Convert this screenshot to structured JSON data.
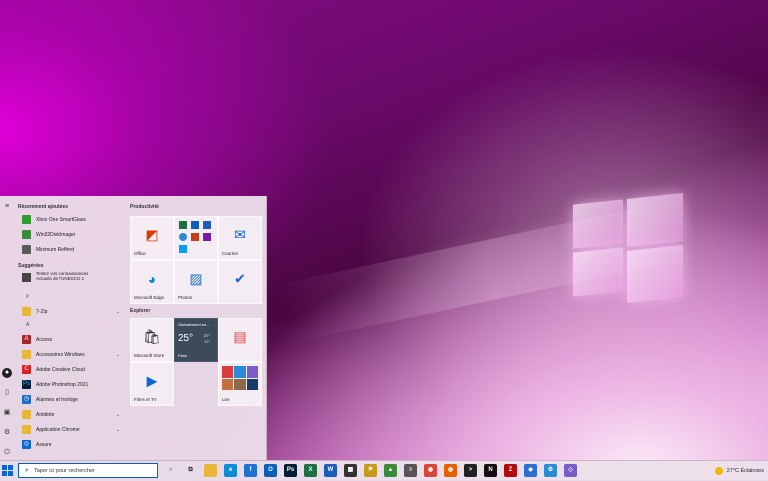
{
  "rail": {
    "icons": [
      "hamburger-icon",
      "user-icon",
      "document-icon",
      "pictures-icon",
      "settings-icon",
      "power-icon"
    ]
  },
  "apps": {
    "recent_heading": "Récemment ajoutées",
    "recent": [
      {
        "label": "Xbox One SmartGlass",
        "color": "#2d9b2d"
      },
      {
        "label": "Win32DiskImager",
        "color": "#3a8a3a"
      },
      {
        "label": "Minimum Refferd",
        "color": "#5a5a5a"
      }
    ],
    "suggestions_heading": "Suggérées",
    "suggestion": {
      "line1": "Testez vos connaissances",
      "line2": "Actualis de l'UNESCO 1",
      "color": "#444"
    },
    "letter_hash": "#",
    "folder_7zip": "7-Zip",
    "letter_a": "A",
    "list": [
      {
        "label": "Access",
        "color": "#a4262c",
        "glyph": "A"
      },
      {
        "label": "Accessoires Windows",
        "color": "#e8b73a",
        "glyph": "",
        "chevron": true
      },
      {
        "label": "Adobe Creative Cloud",
        "color": "#da1f26",
        "glyph": "C"
      },
      {
        "label": "Adobe Photoshop 2021",
        "color": "#001e36",
        "glyph": "Ps"
      },
      {
        "label": "Alarmes et horloge",
        "color": "#1a6fc4",
        "glyph": "◷"
      },
      {
        "label": "Antidote",
        "color": "#e8b73a",
        "glyph": "",
        "chevron": true
      },
      {
        "label": "Application Chrome",
        "color": "#e8b73a",
        "glyph": "",
        "chevron": true
      },
      {
        "label": "Assure",
        "color": "#0a66d0",
        "glyph": "◎"
      }
    ]
  },
  "tiles": {
    "productivity_heading": "Productivité",
    "explore_heading": "Explorer",
    "office": "Office",
    "mail": "Courrier",
    "edge": "Microsoft Edge",
    "photos": "Photos",
    "store": "Microsoft Store",
    "weather_top": "Globalement en...",
    "weather_temp": "25°",
    "weather_hi": "27°",
    "weather_lo": "15°",
    "weather_city": "Paris",
    "films": "Films et TV",
    "play": "Lire"
  },
  "taskbar": {
    "search_placeholder": "Taper ici pour rechercher",
    "apps": [
      {
        "name": "cortana-icon",
        "color": "#333",
        "glyph": "○"
      },
      {
        "name": "task-view-icon",
        "color": "#333",
        "glyph": "⧉"
      },
      {
        "name": "file-explorer-icon",
        "color": "#e8b73a",
        "glyph": ""
      },
      {
        "name": "edge-icon",
        "color": "#0c8bd6",
        "glyph": "e"
      },
      {
        "name": "firefox-icon",
        "color": "#1c73d4",
        "glyph": "f"
      },
      {
        "name": "outlook-icon",
        "color": "#0a5fb8",
        "glyph": "O"
      },
      {
        "name": "photoshop-icon",
        "color": "#001e36",
        "glyph": "Ps"
      },
      {
        "name": "excel-icon",
        "color": "#1d7044",
        "glyph": "X"
      },
      {
        "name": "word-icon",
        "color": "#1d5bbd",
        "glyph": "W"
      },
      {
        "name": "store-icon",
        "color": "#333",
        "glyph": "▦"
      },
      {
        "name": "app-yellow-icon",
        "color": "#c79a1a",
        "glyph": "⚑"
      },
      {
        "name": "app-green-icon",
        "color": "#3a8a3a",
        "glyph": "▲"
      },
      {
        "name": "notepad-icon",
        "color": "#555",
        "glyph": "≡"
      },
      {
        "name": "chrome-icon",
        "color": "#db4437",
        "glyph": "◉"
      },
      {
        "name": "firefox2-icon",
        "color": "#e66000",
        "glyph": "◍"
      },
      {
        "name": "terminal-icon",
        "color": "#222",
        "glyph": ">"
      },
      {
        "name": "netflix-icon",
        "color": "#111",
        "glyph": "N"
      },
      {
        "name": "filezilla-icon",
        "color": "#b10b0b",
        "glyph": "Z"
      },
      {
        "name": "app-blue-icon",
        "color": "#2a6fd6",
        "glyph": "◆"
      },
      {
        "name": "settings-app-icon",
        "color": "#2a8bd6",
        "glyph": "⚙"
      },
      {
        "name": "app-purple-icon",
        "color": "#7a5cc8",
        "glyph": "◇"
      }
    ],
    "weather": "27°C  Éclaircies"
  }
}
